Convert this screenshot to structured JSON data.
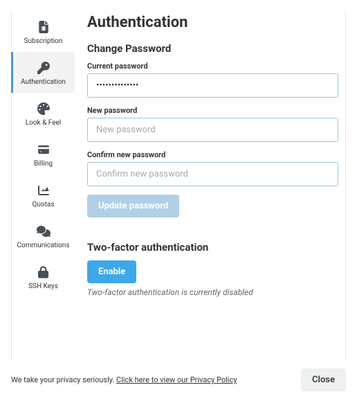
{
  "sidebar": {
    "items": [
      {
        "label": "Subscription"
      },
      {
        "label": "Authentication"
      },
      {
        "label": "Look & Feel"
      },
      {
        "label": "Billing"
      },
      {
        "label": "Quotas"
      },
      {
        "label": "Communications"
      },
      {
        "label": "SSH Keys"
      }
    ]
  },
  "page": {
    "title": "Authentication"
  },
  "password": {
    "heading": "Change Password",
    "current_label": "Current password",
    "current_value": "••••••••••••••",
    "new_label": "New password",
    "new_placeholder": "New password",
    "confirm_label": "Confirm new password",
    "confirm_placeholder": "Confirm new password",
    "update_button": "Update password"
  },
  "twofa": {
    "heading": "Two-factor authentication",
    "enable_button": "Enable",
    "status": "Two-factor authentication is currently disabled"
  },
  "footer": {
    "text": "We take your privacy seriously. ",
    "link": "Click here to view our Privacy Policy",
    "close_button": "Close"
  }
}
